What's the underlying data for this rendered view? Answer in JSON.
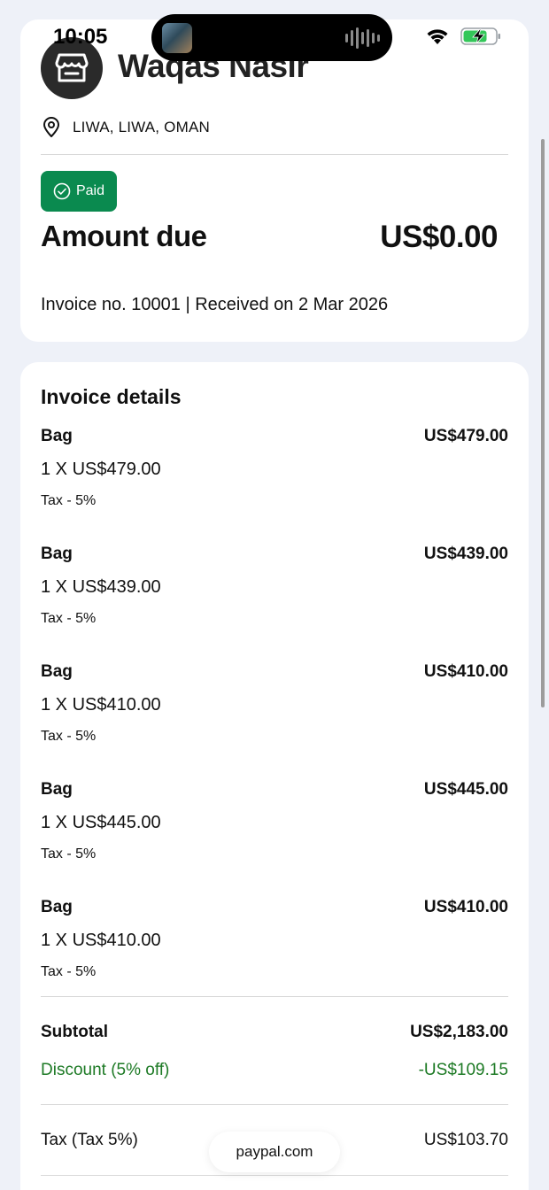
{
  "status_bar": {
    "time": "10:05"
  },
  "merchant": {
    "name": "Waqas Nasir",
    "location": "LIWA, LIWA, OMAN"
  },
  "payment": {
    "status_label": "Paid",
    "amount_label": "Amount due",
    "amount_value": "US$0.00",
    "invoice_meta": "Invoice no. 10001 | Received on 2 Mar 2026"
  },
  "details": {
    "title": "Invoice details",
    "items": [
      {
        "name": "Bag",
        "total": "US$479.00",
        "qty": "1 X US$479.00",
        "tax": "Tax - 5%"
      },
      {
        "name": "Bag",
        "total": "US$439.00",
        "qty": "1 X US$439.00",
        "tax": "Tax - 5%"
      },
      {
        "name": "Bag",
        "total": "US$410.00",
        "qty": "1 X US$410.00",
        "tax": "Tax - 5%"
      },
      {
        "name": "Bag",
        "total": "US$445.00",
        "qty": "1 X US$445.00",
        "tax": "Tax - 5%"
      },
      {
        "name": "Bag",
        "total": "US$410.00",
        "qty": "1 X US$410.00",
        "tax": "Tax - 5%"
      }
    ],
    "subtotal_label": "Subtotal",
    "subtotal_value": "US$2,183.00",
    "discount_label": "Discount (5% off)",
    "discount_value": "-US$109.15",
    "tax_label": "Tax (Tax 5%)",
    "tax_value": "US$103.70"
  },
  "browser": {
    "url": "paypal.com"
  },
  "colors": {
    "paid_badge": "#0a8a4f",
    "discount_text": "#1d7a25",
    "page_background": "#eef1f8"
  },
  "icons": {
    "merchant": "store-icon",
    "location": "location-pin-icon",
    "paid": "check-circle-icon"
  }
}
